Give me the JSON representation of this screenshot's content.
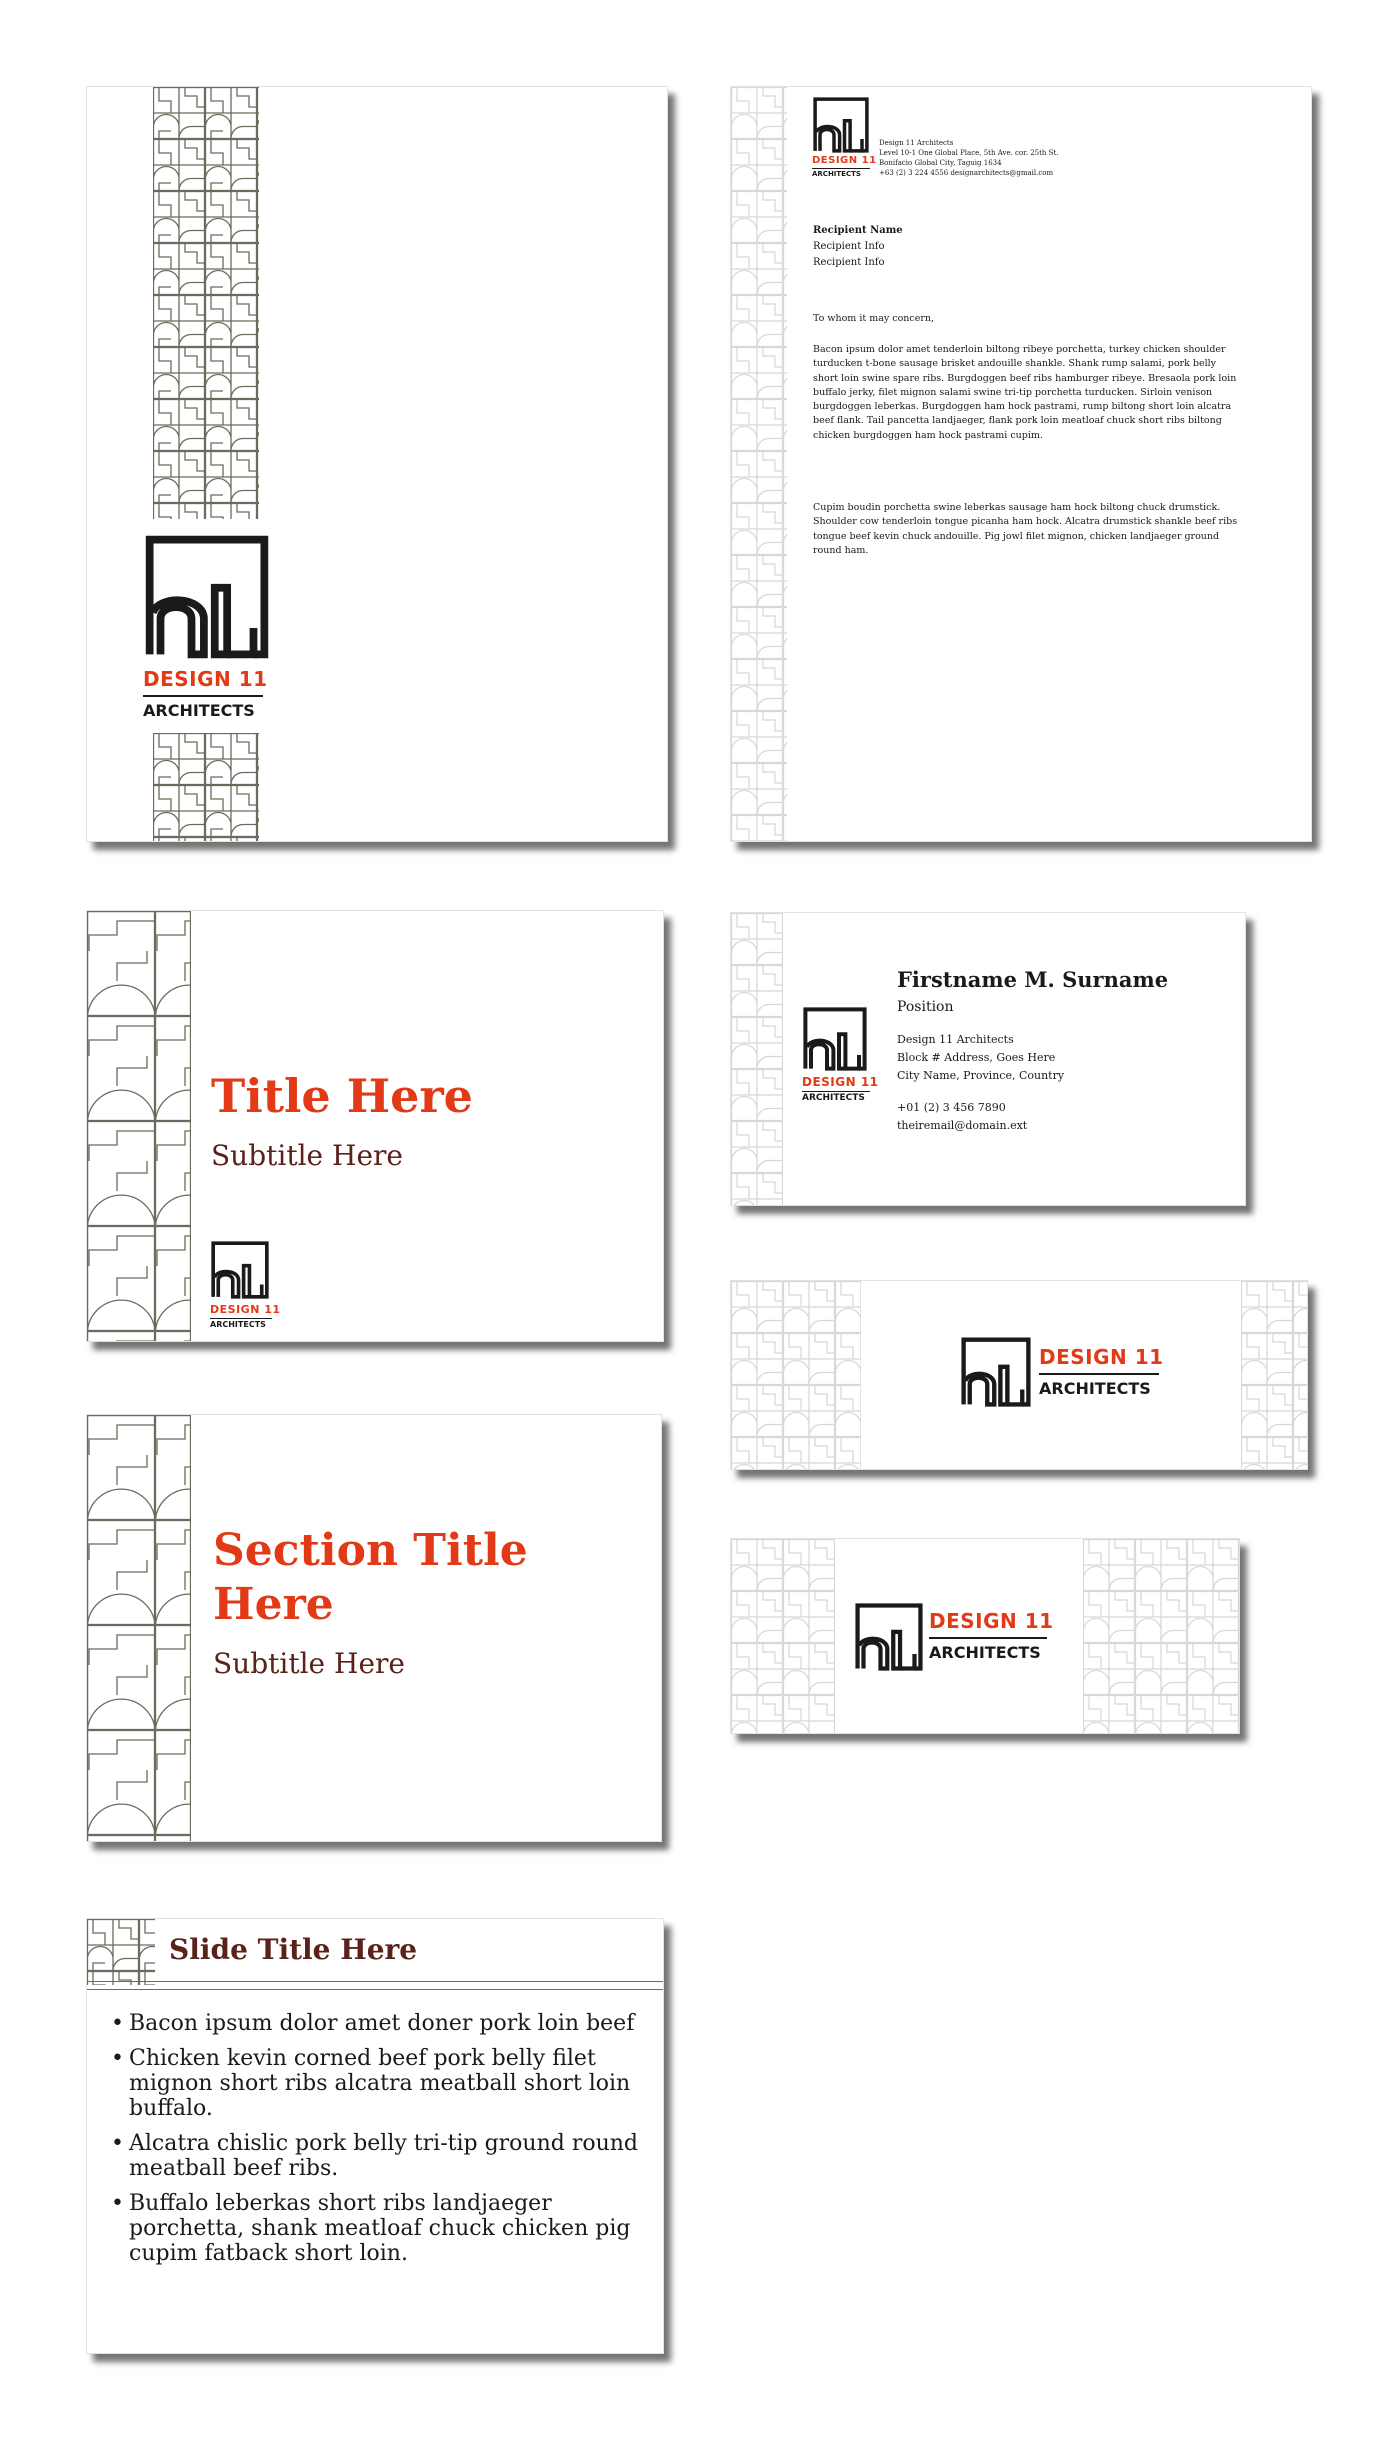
{
  "brand": {
    "name_line1": "DESIGN 11",
    "name_line2": "ARCHITECTS",
    "colors": {
      "accent": "#e23a16",
      "dark": "#1a1a1a",
      "subtitle": "#5a2218",
      "pattern": "#6b6a5c"
    }
  },
  "letterhead": {
    "company": "Design 11 Architects",
    "address_line1": "Level 10-1 One Global Place, 5th Ave. cor. 25th St.",
    "address_line2": "Bonifacio Global City, Taguig 1634",
    "contact": "+63 (2) 3 224 4556 designarchitects@gmail.com",
    "recipient_name": "Recipient Name",
    "recipient_info1": "Recipient Info",
    "recipient_info2": "Recipient Info",
    "salutation": "To whom it may concern,",
    "para1": "Bacon ipsum dolor amet tenderloin biltong ribeye porchetta, turkey chicken shoulder turducken t-bone sausage brisket andouille shankle. Shank rump salami, pork belly short loin swine spare ribs. Burgdoggen beef ribs hamburger ribeye. Bresaola pork loin buffalo jerky, filet mignon salami swine tri-tip porchetta turducken. Sirloin venison burgdoggen leberkas. Burgdoggen ham hock pastrami, rump biltong short loin alcatra beef flank. Tail pancetta landjaeger, flank pork loin meatloaf chuck short ribs biltong chicken burgdoggen ham hock pastrami cupim.",
    "para2": "Cupim boudin porchetta swine leberkas sausage ham hock biltong chuck drumstick. Shoulder cow tenderloin tongue picanha ham hock. Alcatra drumstick shankle beef ribs tongue beef kevin chuck andouille. Pig jowl filet mignon, chicken landjaeger ground round ham."
  },
  "business_card": {
    "name": "Firstname M. Surname",
    "position": "Position",
    "company": "Design 11 Architects",
    "address1": "Block # Address, Goes Here",
    "address2": "City Name, Province, Country",
    "phone": "+01 (2) 3 456 7890",
    "email": "theiremail@domain.ext"
  },
  "title_slide": {
    "title": "Title Here",
    "subtitle": "Subtitle Here"
  },
  "section_slide": {
    "title_line1": "Section Title",
    "title_line2": "Here",
    "subtitle": "Subtitle Here"
  },
  "content_slide": {
    "title": "Slide Title Here",
    "bullets": [
      "Bacon ipsum dolor amet doner pork loin beef",
      "Chicken kevin corned beef pork belly filet mignon short ribs alcatra meatball short loin buffalo.",
      "Alcatra chislic pork belly tri-tip ground round meatball beef ribs.",
      "Buffalo leberkas short ribs landjaeger porchetta, shank meatloaf chuck chicken pig cupim fatback short loin."
    ]
  }
}
